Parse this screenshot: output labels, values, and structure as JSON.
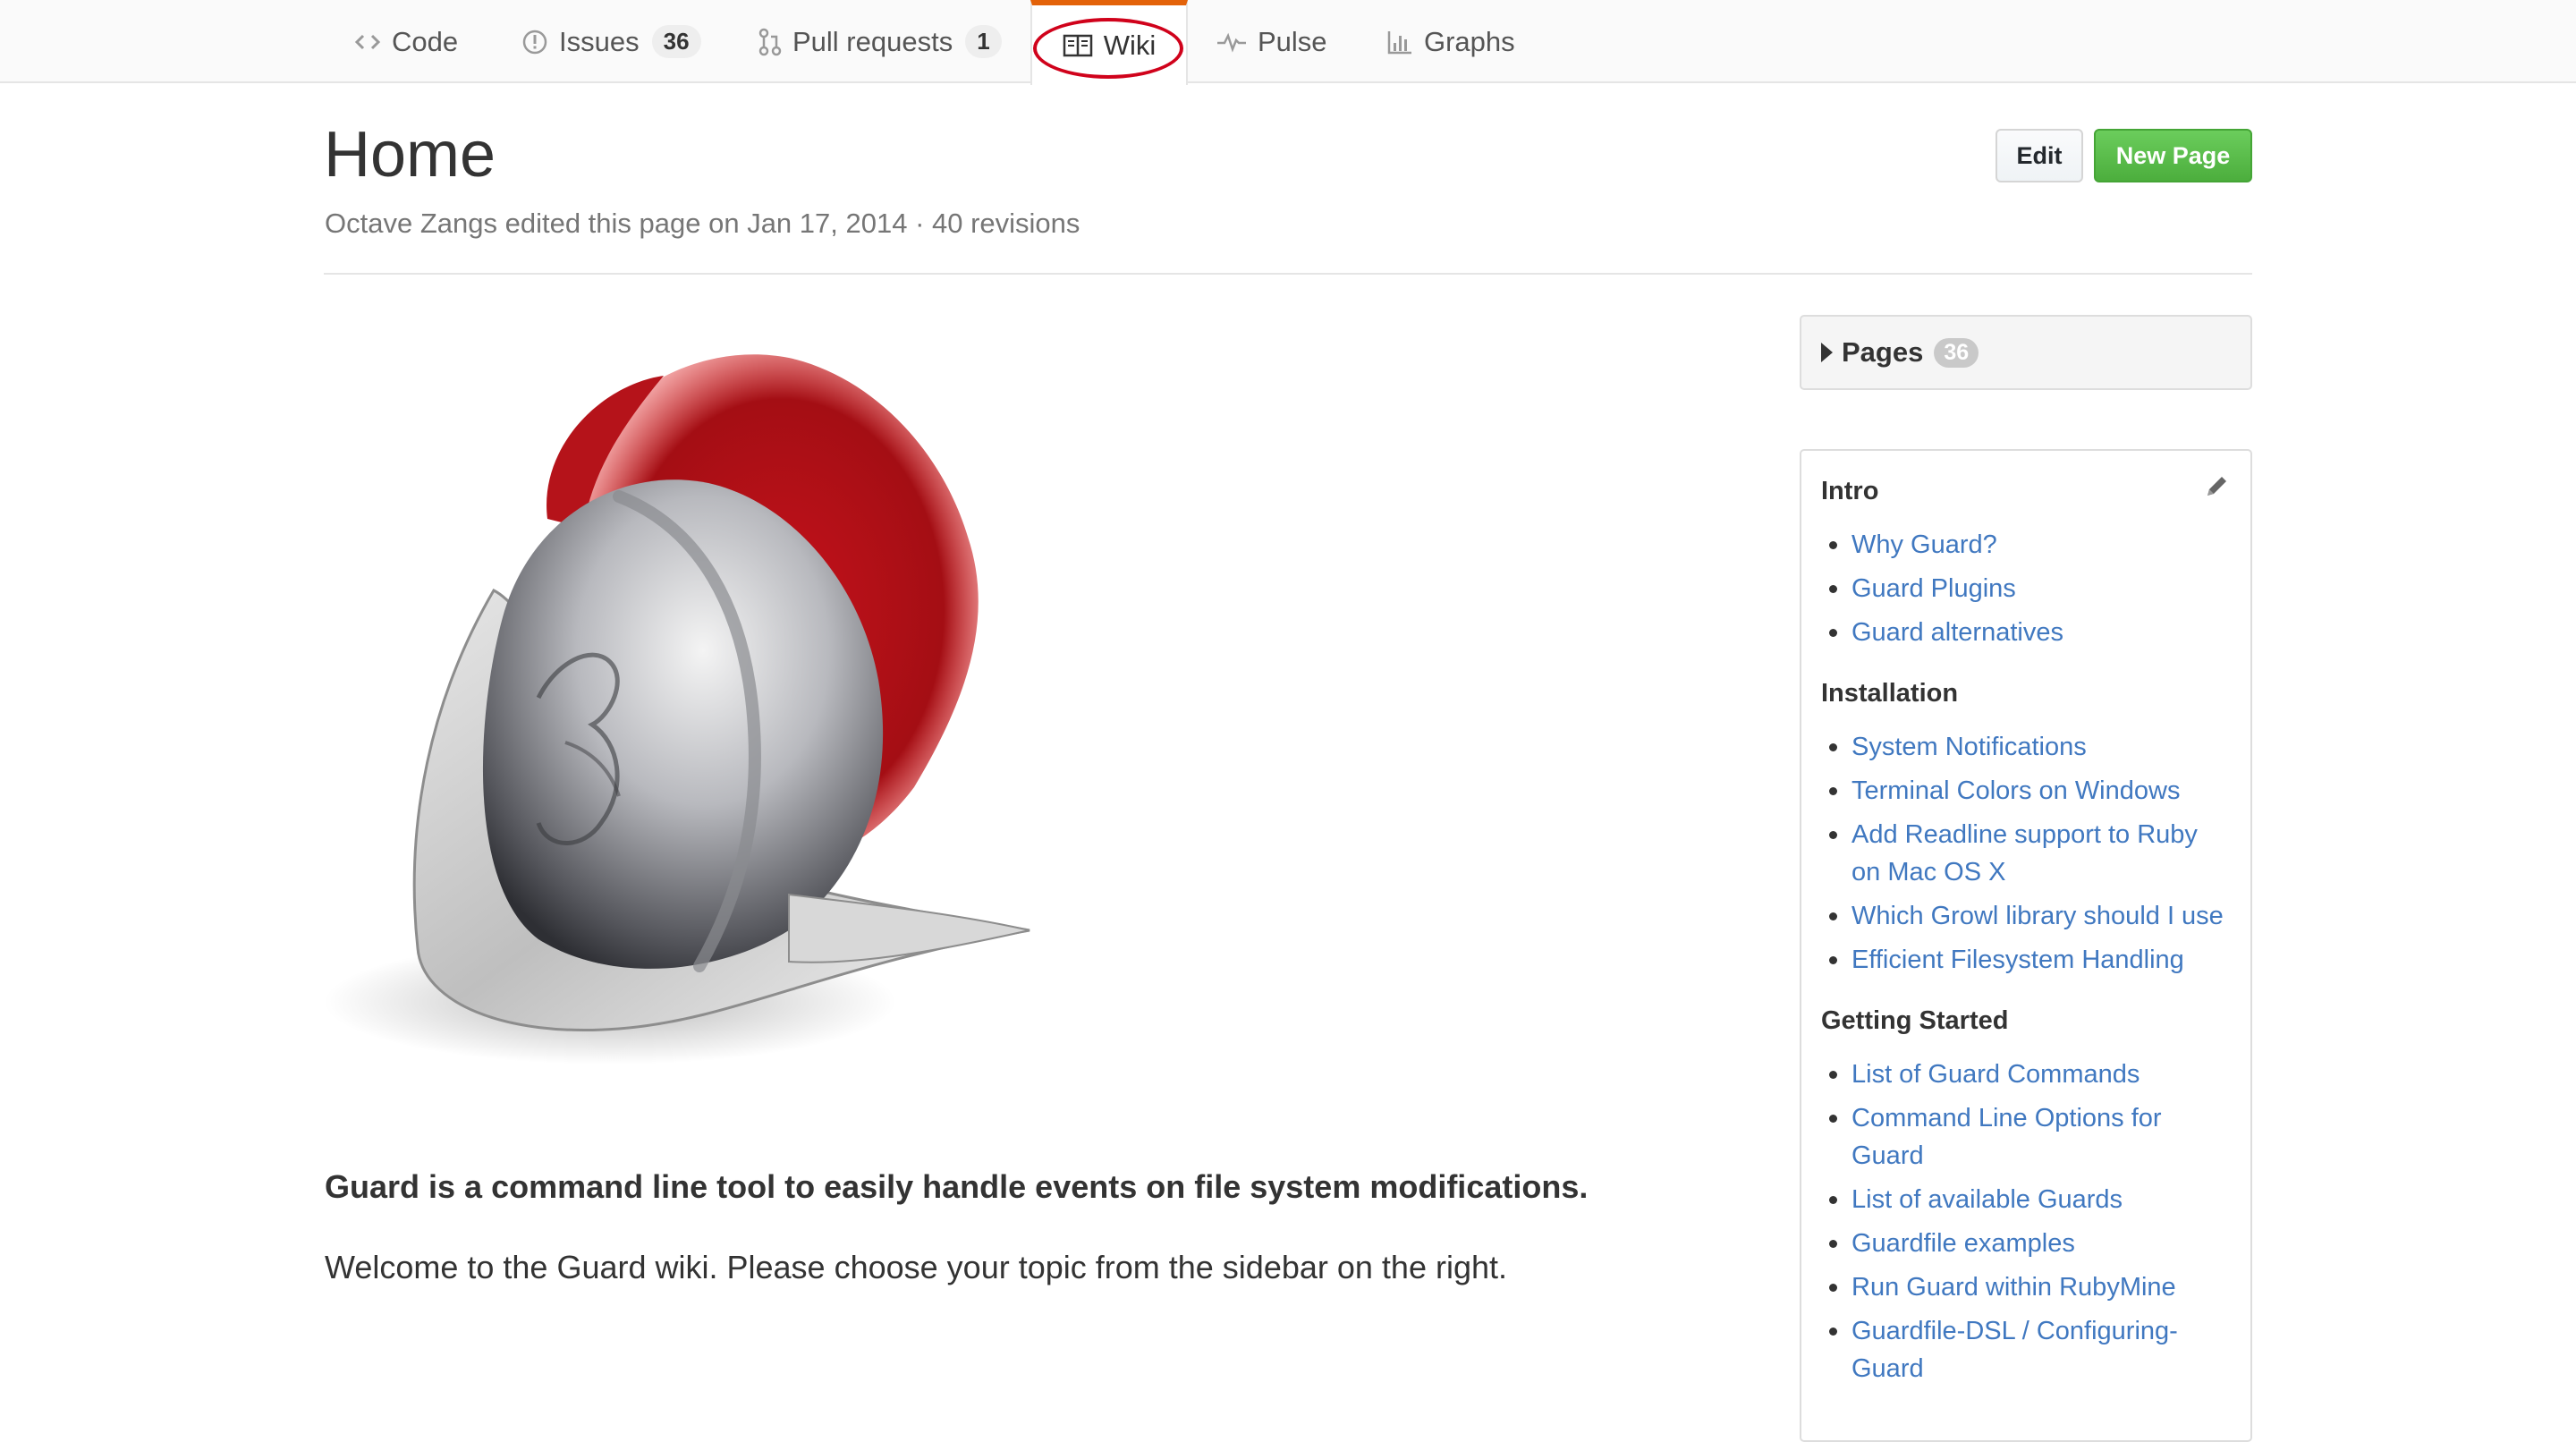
{
  "tabs": [
    {
      "label": "Code",
      "icon": "code-icon"
    },
    {
      "label": "Issues",
      "icon": "issue-opened-icon",
      "count": "36"
    },
    {
      "label": "Pull requests",
      "icon": "git-pull-request-icon",
      "count": "1"
    },
    {
      "label": "Wiki",
      "icon": "book-icon",
      "selected": true
    },
    {
      "label": "Pulse",
      "icon": "pulse-icon"
    },
    {
      "label": "Graphs",
      "icon": "graph-icon"
    }
  ],
  "page": {
    "title": "Home",
    "meta": "Octave Zangs edited this page on Jan 17, 2014 · 40 revisions",
    "edit_label": "Edit",
    "new_page_label": "New Page"
  },
  "content": {
    "lead": "Guard is a command line tool to easily handle events on file system modifications.",
    "welcome": "Welcome to the Guard wiki. Please choose your topic from the sidebar on the right."
  },
  "sidebar": {
    "pages_label": "Pages",
    "pages_count": "36",
    "sections": [
      {
        "title": "Intro",
        "links": [
          "Why Guard?",
          "Guard Plugins",
          "Guard alternatives"
        ]
      },
      {
        "title": "Installation",
        "links": [
          "System Notifications",
          "Terminal Colors on Windows",
          "Add Readline support to Ruby on Mac OS X",
          "Which Growl library should I use",
          "Efficient Filesystem Handling"
        ]
      },
      {
        "title": "Getting Started",
        "links": [
          "List of Guard Commands",
          "Command Line Options for Guard",
          "List of available Guards",
          "Guardfile examples",
          "Run Guard within RubyMine",
          "Guardfile-DSL / Configuring-Guard"
        ]
      }
    ]
  },
  "colors": {
    "link": "#4078c0",
    "tab_selected_border": "#e36209",
    "annotation": "#d0021b",
    "new_page_button": "#55b944"
  }
}
